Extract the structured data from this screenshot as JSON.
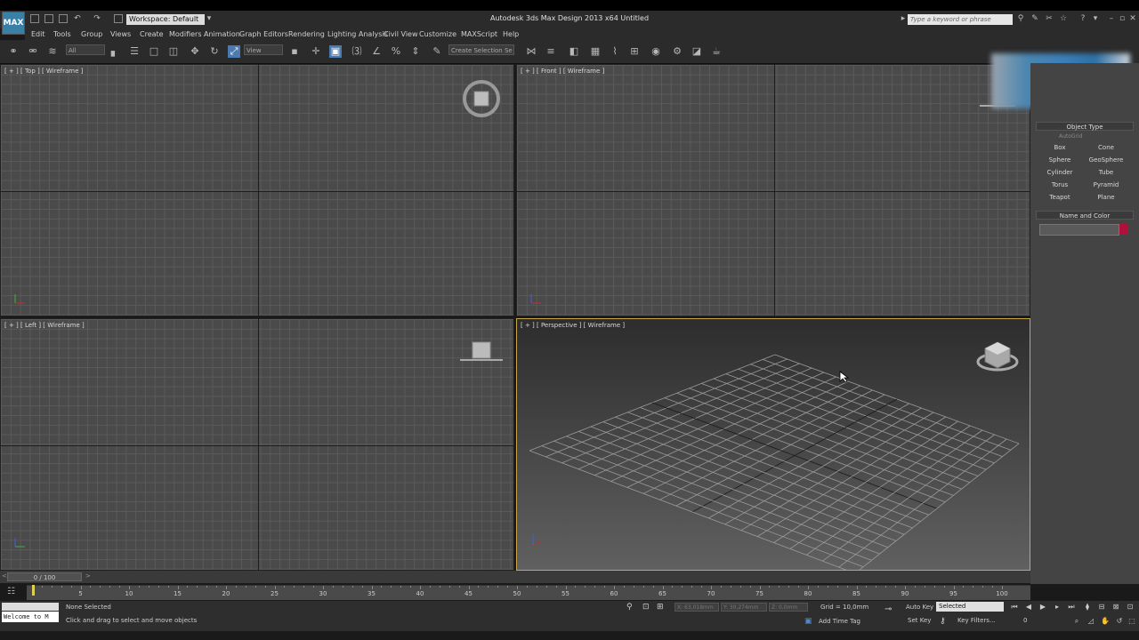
{
  "window": {
    "title": "Autodesk 3ds Max Design 2013 x64    Untitled",
    "logo_text": "MAX",
    "workspace": "Workspace: Default",
    "search_placeholder": "Type a keyword or phrase"
  },
  "menu": [
    "Edit",
    "Tools",
    "Group",
    "Views",
    "Create",
    "Modifiers",
    "Animation",
    "Graph Editors",
    "Rendering",
    "Lighting Analysis",
    "Civil View",
    "Customize",
    "MAXScript",
    "Help"
  ],
  "toolbar": {
    "filter_value": "All",
    "refcoord_value": "View",
    "selection_set_placeholder": "Create Selection Se"
  },
  "viewports": {
    "top": "[ + ] [ Top ] [ Wireframe ]",
    "front": "[ + ] [ Front ] [ Wireframe ]",
    "left": "[ + ] [ Left ] [ Wireframe ]",
    "perspective": "[ + ] [ Perspective ] [ Wireframe ]"
  },
  "command_panel": {
    "object_type_title": "Object Type",
    "autogrid": "AutoGrid",
    "objects": [
      "Box",
      "Cone",
      "Sphere",
      "GeoSphere",
      "Cylinder",
      "Tube",
      "Torus",
      "Pyramid",
      "Teapot",
      "Plane"
    ],
    "name_color_title": "Name and Color",
    "swatch_color": "#b0103a"
  },
  "timeline": {
    "frame_display": "0 / 100",
    "ticks": [
      "5",
      "10",
      "15",
      "20",
      "25",
      "30",
      "35",
      "40",
      "45",
      "50",
      "55",
      "60",
      "65",
      "70",
      "75",
      "80",
      "85",
      "90",
      "95",
      "100"
    ]
  },
  "status": {
    "maxscript": "Welcome to M",
    "selection": "None Selected",
    "prompt": "Click and drag to select and move objects",
    "x": "X: 63,018mm",
    "y": "Y: 30,274mm",
    "z": "Z: 0,0mm",
    "grid": "Grid = 10,0mm",
    "add_time_tag": "Add Time Tag",
    "auto_key": "Auto Key",
    "set_key": "Set Key",
    "selected_dropdown": "Selected",
    "key_filters": "Key Filters...",
    "frame_field": "0"
  }
}
